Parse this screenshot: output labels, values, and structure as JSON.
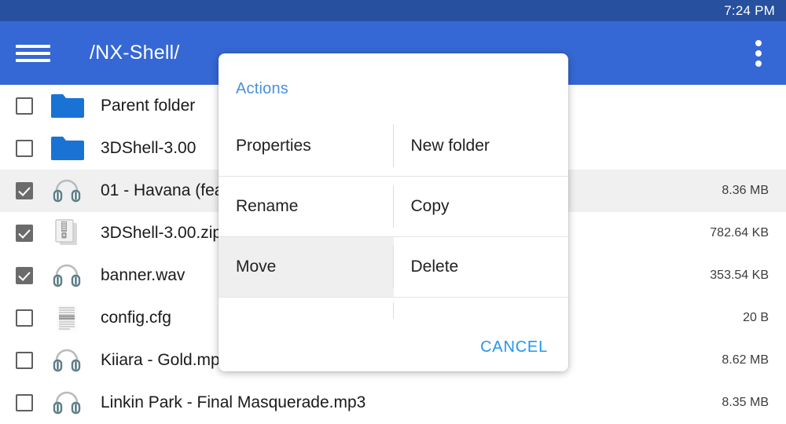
{
  "status_bar": {
    "clock": "7:24 PM",
    "background": "#27509f"
  },
  "app_bar": {
    "menu_icon": "hamburger-menu-icon",
    "title": "/NX-Shell/",
    "overflow_icon": "more-vert-icon",
    "background": "#3568d4"
  },
  "file_list": {
    "rows": [
      {
        "name": "Parent folder",
        "size": "",
        "icon": "folder-icon",
        "checked": false,
        "highlighted": false
      },
      {
        "name": "3DShell-3.00",
        "size": "",
        "icon": "folder-icon",
        "checked": false,
        "highlighted": false
      },
      {
        "name": "01 - Havana (fea",
        "size": "8.36 MB",
        "icon": "audio-headphones-icon",
        "checked": true,
        "highlighted": true
      },
      {
        "name": "3DShell-3.00.zip",
        "size": "782.64 KB",
        "icon": "archive-zip-icon",
        "checked": true,
        "highlighted": false
      },
      {
        "name": "banner.wav",
        "size": "353.54 KB",
        "icon": "audio-headphones-icon",
        "checked": true,
        "highlighted": false
      },
      {
        "name": "config.cfg",
        "size": "20 B",
        "icon": "text-document-icon",
        "checked": false,
        "highlighted": false
      },
      {
        "name": "Kiiara - Gold.mp3",
        "size": "8.62 MB",
        "icon": "audio-headphones-icon",
        "checked": false,
        "highlighted": false
      },
      {
        "name": "Linkin Park - Final Masquerade.mp3",
        "size": "8.35 MB",
        "icon": "audio-headphones-icon",
        "checked": false,
        "highlighted": false
      }
    ]
  },
  "dialog": {
    "title": "Actions",
    "title_color": "#4a90d9",
    "cells": [
      {
        "label": "Properties",
        "pressed": false
      },
      {
        "label": "New folder",
        "pressed": false
      },
      {
        "label": "Rename",
        "pressed": false
      },
      {
        "label": "Copy",
        "pressed": false
      },
      {
        "label": "Move",
        "pressed": true
      },
      {
        "label": "Delete",
        "pressed": false
      }
    ],
    "cancel_label": "CANCEL",
    "cancel_color": "#2196f3"
  }
}
